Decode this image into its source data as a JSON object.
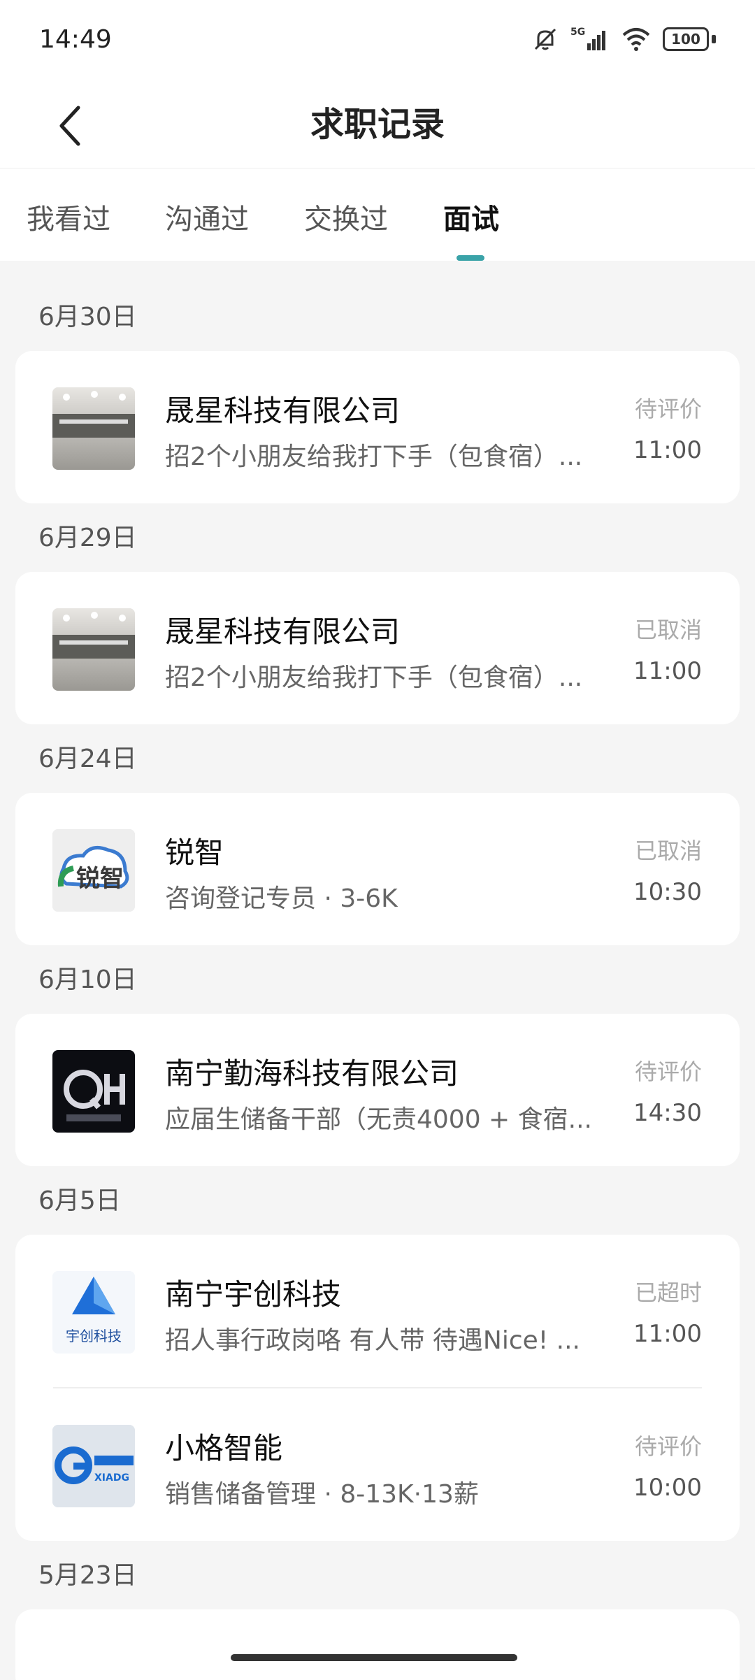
{
  "status_bar": {
    "time": "14:49",
    "battery": "100"
  },
  "header": {
    "title": "求职记录"
  },
  "tabs": [
    {
      "label": "我看过"
    },
    {
      "label": "沟通过"
    },
    {
      "label": "交换过"
    },
    {
      "label": "面试",
      "active": true
    }
  ],
  "groups": [
    {
      "date": "6月30日",
      "items": [
        {
          "company": "晟星科技有限公司",
          "job": "招2个小朋友给我打下手（包食宿）...",
          "status": "待评价",
          "time": "11:00",
          "logo": "office-photo"
        }
      ]
    },
    {
      "date": "6月29日",
      "items": [
        {
          "company": "晟星科技有限公司",
          "job": "招2个小朋友给我打下手（包食宿）...",
          "status": "已取消",
          "time": "11:00",
          "logo": "office-photo"
        }
      ]
    },
    {
      "date": "6月24日",
      "items": [
        {
          "company": "锐智",
          "job": "咨询登记专员 · 3-6K",
          "status": "已取消",
          "time": "10:30",
          "logo": "ruizhi-logo"
        }
      ]
    },
    {
      "date": "6月10日",
      "items": [
        {
          "company": "南宁勤海科技有限公司",
          "job": "应届生储备干部（无责4000 + 食宿...",
          "status": "待评价",
          "time": "14:30",
          "logo": "qh-logo"
        }
      ]
    },
    {
      "date": "6月5日",
      "items": [
        {
          "company": "南宁宇创科技",
          "job": "招人事行政岗咯 有人带 待遇Nice! ...",
          "status": "已超时",
          "time": "11:00",
          "logo": "yuchuang-logo"
        },
        {
          "company": "小格智能",
          "job": "销售储备管理 · 8-13K·13薪",
          "status": "待评价",
          "time": "10:00",
          "logo": "xiaoge-logo"
        }
      ]
    },
    {
      "date": "5月23日",
      "items": []
    }
  ],
  "colors": {
    "accent": "#3aa3a8",
    "background": "#f5f5f5"
  }
}
